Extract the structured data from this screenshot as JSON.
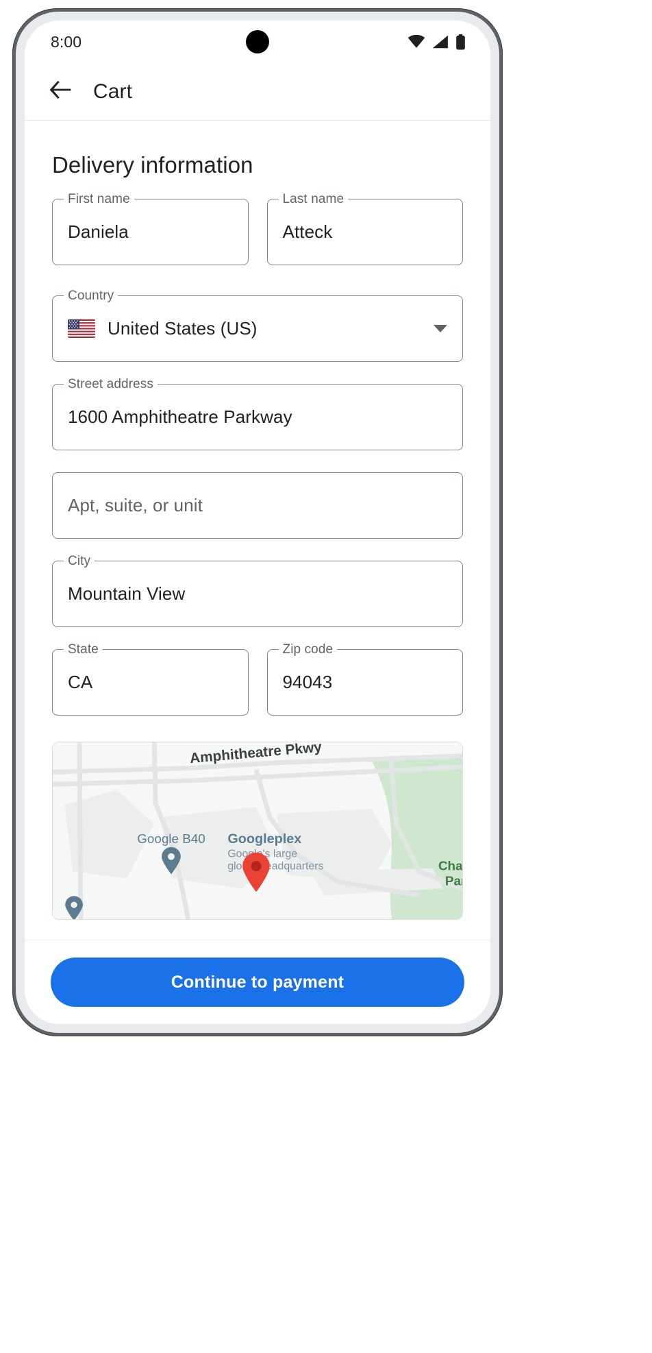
{
  "status_bar": {
    "time": "8:00",
    "icons": [
      "wifi-icon",
      "cell-signal-icon",
      "battery-icon"
    ]
  },
  "app_bar": {
    "back_icon": "arrow-back-icon",
    "title": "Cart"
  },
  "main": {
    "section_title": "Delivery information",
    "fields": [
      {
        "name": "first-name",
        "label": "First name",
        "value": "Daniela",
        "placeholder": ""
      },
      {
        "name": "last-name",
        "label": "Last name",
        "value": "Atteck",
        "placeholder": ""
      },
      {
        "name": "country",
        "label": "Country",
        "value": "United States (US)",
        "placeholder": "",
        "flag": "us-flag-icon",
        "caret": "chevron-down-icon"
      },
      {
        "name": "street-address",
        "label": "Street address",
        "value": "1600 Amphitheatre Parkway",
        "placeholder": ""
      },
      {
        "name": "apt-suite-unit",
        "label": "",
        "value": "",
        "placeholder": "Apt, suite, or unit"
      },
      {
        "name": "city",
        "label": "City",
        "value": "Mountain View",
        "placeholder": ""
      },
      {
        "name": "state",
        "label": "State",
        "value": "CA",
        "placeholder": ""
      },
      {
        "name": "zip-code",
        "label": "Zip code",
        "value": "94043",
        "placeholder": ""
      }
    ],
    "map": {
      "street_label": "Amphitheatre Pkwy",
      "poi_b40": "Google B40",
      "poi_googleplex": "Googleplex",
      "poi_googleplex_sub1": "Google's large",
      "poi_googleplex_sub2": "global headquarters",
      "park_label": "Charle",
      "park_label2": "Par",
      "marker": "map-pin-icon"
    }
  },
  "bottom_bar": {
    "cta_label": "Continue to payment"
  },
  "colors": {
    "accent_blue": "#1b72e8",
    "text_primary": "#202124",
    "text_secondary": "#5f6368",
    "field_border": "#80868b",
    "map_marker_red": "#ea4335",
    "map_poi_blue": "#5d7b8f",
    "map_park_green": "#cfe6cf"
  }
}
